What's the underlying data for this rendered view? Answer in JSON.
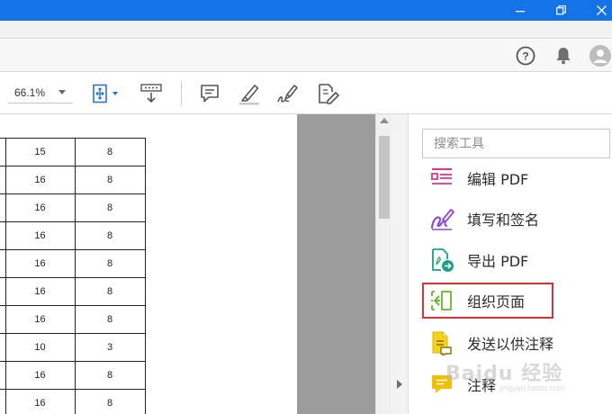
{
  "toolbar": {
    "zoom_value": "66.1%"
  },
  "table": {
    "rows": [
      [
        "",
        "15",
        "8"
      ],
      [
        "",
        "16",
        "8"
      ],
      [
        "",
        "16",
        "8"
      ],
      [
        "",
        "16",
        "8"
      ],
      [
        "",
        "16",
        "8"
      ],
      [
        "",
        "16",
        "8"
      ],
      [
        "",
        "16",
        "8"
      ],
      [
        "",
        "10",
        "3"
      ],
      [
        "",
        "16",
        "8"
      ],
      [
        "",
        "16",
        "8"
      ]
    ]
  },
  "right_panel": {
    "search_placeholder": "搜索工具",
    "tools": [
      {
        "label": "编辑 PDF",
        "icon": "edit-pdf-icon"
      },
      {
        "label": "填写和签名",
        "icon": "fill-sign-icon"
      },
      {
        "label": "导出 PDF",
        "icon": "export-pdf-icon"
      },
      {
        "label": "组织页面",
        "icon": "organize-pages-icon"
      },
      {
        "label": "发送以供注释",
        "icon": "send-for-comments-icon"
      },
      {
        "label": "注释",
        "icon": "comment-icon"
      }
    ],
    "highlighted_tool_index": 3
  },
  "watermark": {
    "text": "Baidu 经验",
    "sub": "jingyan.baidu.com"
  },
  "colors": {
    "titlebar": "#1473e6",
    "highlight_border": "#d9303a",
    "edit_pdf": "#e3338a",
    "fill_sign": "#8a4fd6",
    "export_pdf": "#1aa086",
    "organize": "#6ab52e",
    "send_comments": "#e6b800",
    "comment": "#f0c000"
  }
}
